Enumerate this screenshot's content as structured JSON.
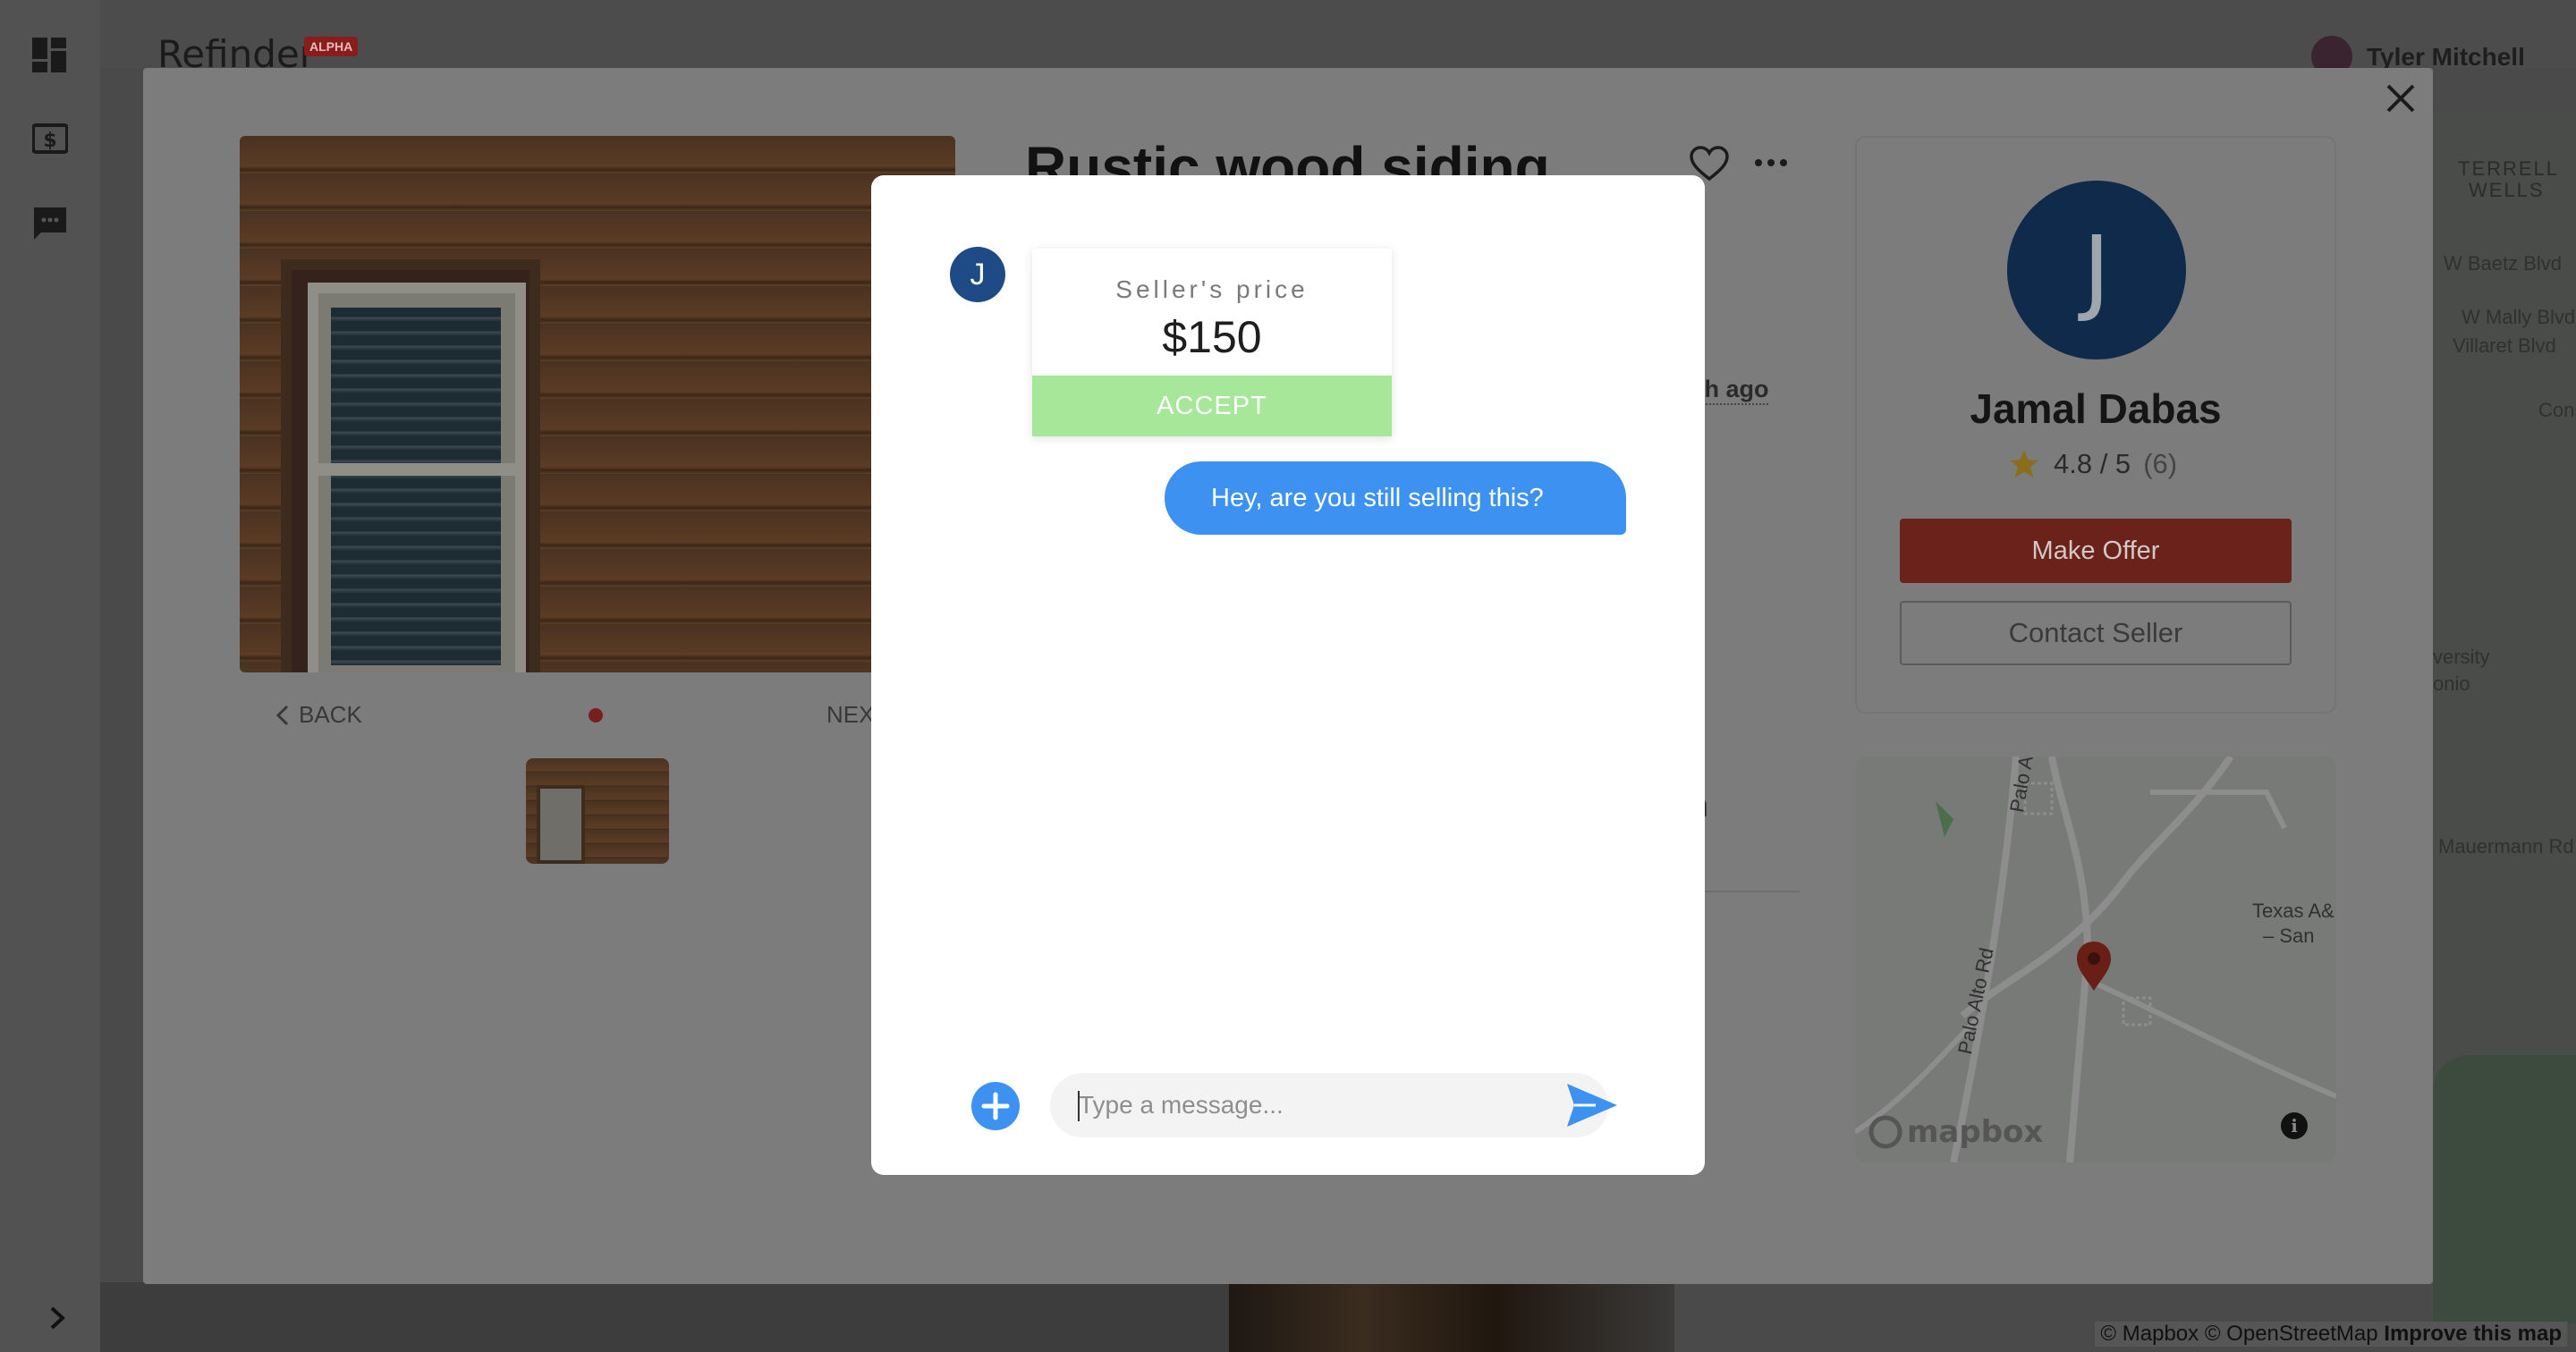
{
  "app": {
    "brand": "Refinder",
    "badge": "ALPHA",
    "user_name": "Tyler Mitchell"
  },
  "rail": {
    "icons": [
      "dashboard-icon",
      "dollar-icon",
      "chat-icon"
    ],
    "expand_icon": "chevron-right-icon"
  },
  "listing": {
    "title": "Rustic wood siding",
    "posted": "nth ago",
    "fragment": "n",
    "gallery": {
      "back": "BACK",
      "next": "NEX"
    }
  },
  "seller": {
    "initial": "J",
    "name": "Jamal Dabas",
    "rating": "4.8 / 5",
    "rating_count": "(6)",
    "make_offer": "Make Offer",
    "contact": "Contact Seller"
  },
  "map": {
    "labels": [
      "Palo Alto Rd",
      "Palo A",
      "Texas A&",
      "– San"
    ],
    "bg_labels": [
      "TERRELL",
      "WELLS",
      "W Baetz Blvd",
      "W Mally Blvd",
      "Villaret Blvd",
      "Cons",
      "versity",
      "onio",
      "Mauermann Rd"
    ],
    "attribution": "© Mapbox © OpenStreetMap",
    "improve": "Improve this map",
    "logo": "mapbox",
    "info": "i"
  },
  "chat": {
    "avatar_initial": "J",
    "offer_label": "Seller's price",
    "offer_price": "$150",
    "accept": "ACCEPT",
    "messages": [
      {
        "from": "me",
        "text": "Hey, are you still selling this?"
      }
    ],
    "input_placeholder": "Type a message...",
    "input_value": ""
  },
  "colors": {
    "accent": "#3d91f0",
    "accept": "#a6e799",
    "offer_button": "#c0392b",
    "avatar": "#1e4a85"
  }
}
